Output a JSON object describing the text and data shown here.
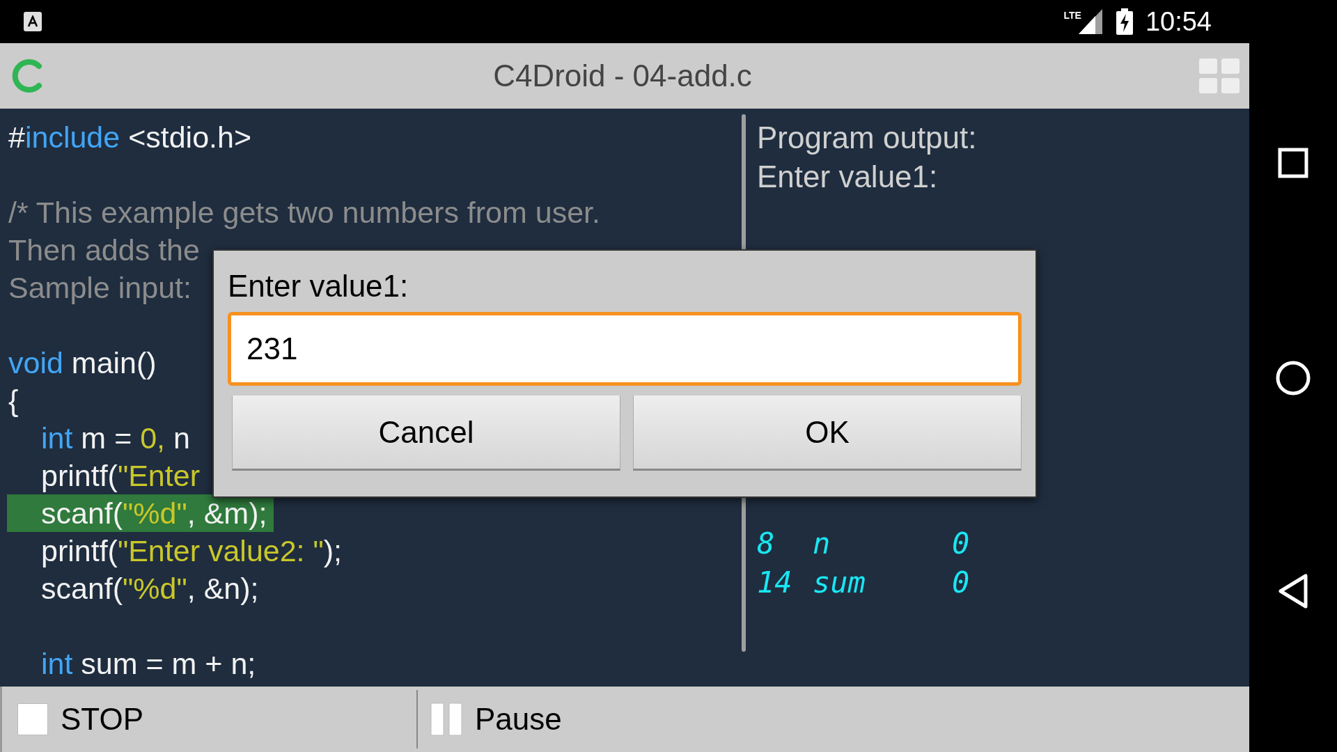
{
  "status_bar": {
    "network": "LTE",
    "time": "10:54"
  },
  "app_bar": {
    "title": "C4Droid - 04-add.c"
  },
  "code": {
    "lines": [
      {
        "kind": "code",
        "segments": [
          {
            "text": "#",
            "kind": "plain"
          },
          {
            "text": "include",
            "kind": "keyword"
          },
          {
            "text": " <stdio.h>",
            "kind": "plain"
          }
        ],
        "indented": false,
        "highlighted": false
      },
      {
        "kind": "blank"
      },
      {
        "kind": "code",
        "segments": [
          {
            "text": "/* This example gets two numbers from user.",
            "kind": "comment"
          }
        ],
        "indented": false,
        "highlighted": false
      },
      {
        "kind": "code",
        "segments": [
          {
            "text": "Then adds the",
            "kind": "comment"
          }
        ],
        "indented": false,
        "highlighted": false
      },
      {
        "kind": "code",
        "segments": [
          {
            "text": "Sample input:",
            "kind": "comment"
          }
        ],
        "indented": false,
        "highlighted": false
      },
      {
        "kind": "blank"
      },
      {
        "kind": "code",
        "segments": [
          {
            "text": "void",
            "kind": "keyword"
          },
          {
            "text": " main()",
            "kind": "plain"
          }
        ],
        "indented": false,
        "highlighted": false
      },
      {
        "kind": "code",
        "segments": [
          {
            "text": "{",
            "kind": "plain"
          }
        ],
        "indented": false,
        "highlighted": false
      },
      {
        "kind": "code",
        "segments": [
          {
            "text": "int",
            "kind": "keyword"
          },
          {
            "text": " m = ",
            "kind": "plain"
          },
          {
            "text": "0,",
            "kind": "number"
          },
          {
            "text": " n",
            "kind": "plain"
          }
        ],
        "indented": true,
        "highlighted": false
      },
      {
        "kind": "code",
        "segments": [
          {
            "text": "printf(",
            "kind": "plain"
          },
          {
            "text": "\"Enter",
            "kind": "string"
          }
        ],
        "indented": true,
        "highlighted": false
      },
      {
        "kind": "code",
        "segments": [
          {
            "text": "scanf(",
            "kind": "plain"
          },
          {
            "text": "\"%d\"",
            "kind": "string"
          },
          {
            "text": ", &m);",
            "kind": "plain"
          }
        ],
        "indented": true,
        "highlighted": true
      },
      {
        "kind": "code",
        "segments": [
          {
            "text": "printf(",
            "kind": "plain"
          },
          {
            "text": "\"Enter value2: \"",
            "kind": "string"
          },
          {
            "text": ");",
            "kind": "plain"
          }
        ],
        "indented": true,
        "highlighted": false
      },
      {
        "kind": "code",
        "segments": [
          {
            "text": "scanf(",
            "kind": "plain"
          },
          {
            "text": "\"%d\"",
            "kind": "string"
          },
          {
            "text": ", &n);",
            "kind": "plain"
          }
        ],
        "indented": true,
        "highlighted": false
      },
      {
        "kind": "blank"
      },
      {
        "kind": "code",
        "segments": [
          {
            "text": "int",
            "kind": "keyword"
          },
          {
            "text": " sum = m + n;",
            "kind": "plain"
          }
        ],
        "indented": true,
        "highlighted": false
      }
    ]
  },
  "output": {
    "lines": [
      "Program output:",
      "Enter value1:"
    ],
    "variables": [
      {
        "line": "8",
        "name": "n",
        "value": "0"
      },
      {
        "line": "14",
        "name": "sum",
        "value": "0"
      }
    ]
  },
  "dialog": {
    "label": "Enter value1:",
    "value": "231",
    "buttons": [
      "Cancel",
      "OK"
    ]
  },
  "bottom_bar": {
    "stop": "STOP",
    "pause": "Pause"
  }
}
